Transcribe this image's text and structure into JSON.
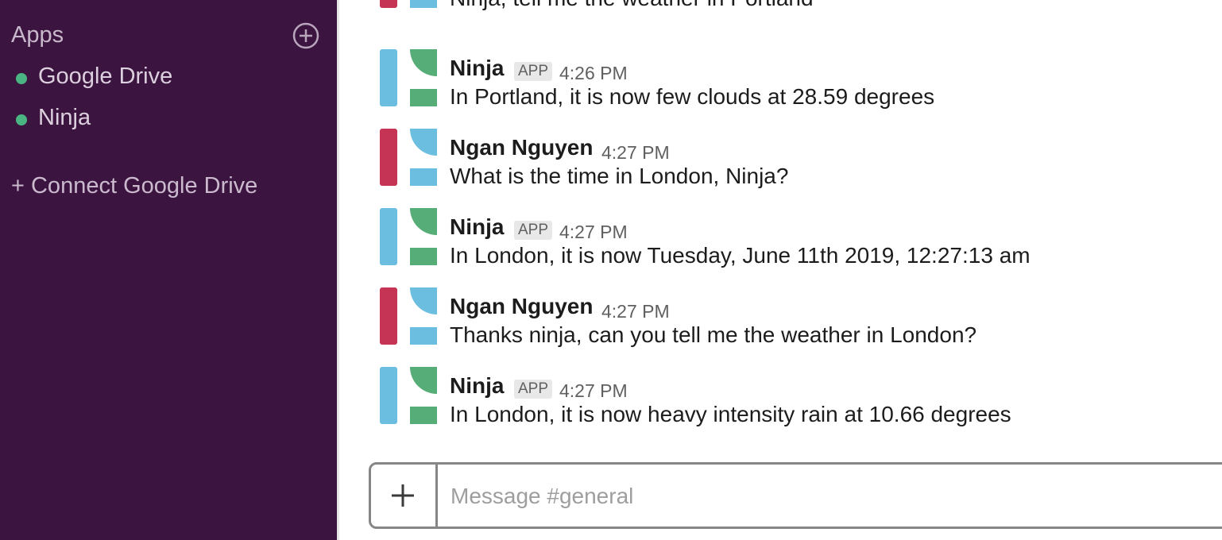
{
  "sidebar": {
    "apps_title": "Apps",
    "apps": [
      {
        "label": "Google Drive",
        "status": "online"
      },
      {
        "label": "Ninja",
        "status": "online"
      }
    ],
    "connect_label": "+ Connect Google Drive"
  },
  "messages": [
    {
      "text": "Ninja, tell me the weather in Portland",
      "avatar": "user-avatar"
    },
    {
      "name": "Ninja",
      "badge": "APP",
      "time": "4:26 PM",
      "text": "In Portland, it is now few clouds at 28.59 degrees",
      "avatar": "bot-avatar"
    },
    {
      "name": "Ngan Nguyen",
      "time": "4:27 PM",
      "text": "What is the time in London, Ninja?",
      "avatar": "user-avatar"
    },
    {
      "name": "Ninja",
      "badge": "APP",
      "time": "4:27 PM",
      "text": "In London, it is now Tuesday, June 11th 2019, 12:27:13 am",
      "avatar": "bot-avatar"
    },
    {
      "name": "Ngan Nguyen",
      "time": "4:27 PM",
      "text": "Thanks ninja, can you tell me the weather in London?",
      "avatar": "user-avatar"
    },
    {
      "name": "Ninja",
      "badge": "APP",
      "time": "4:27 PM",
      "text": "In London, it is now heavy intensity rain at 10.66 degrees",
      "avatar": "bot-avatar"
    }
  ],
  "composer": {
    "placeholder": "Message #general",
    "value": ""
  },
  "colors": {
    "sidebar_bg": "#3b1540",
    "online_dot": "#4ab583",
    "user_avatar_red": "#c53455",
    "avatar_blue": "#6bbedf",
    "bot_avatar_green": "#57ad78"
  }
}
